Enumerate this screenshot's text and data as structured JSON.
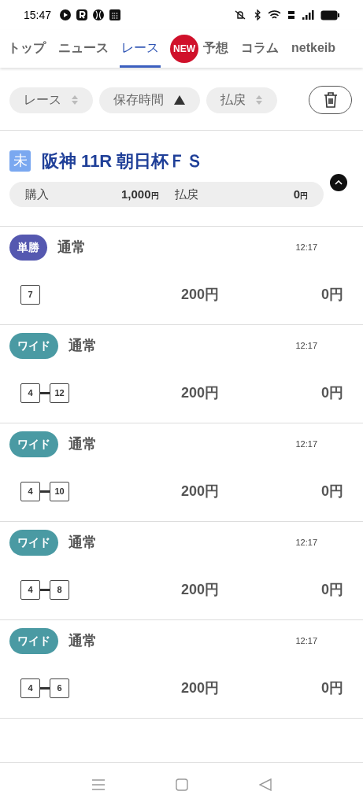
{
  "status_bar": {
    "time": "15:47"
  },
  "tabs": [
    {
      "label": "トップ",
      "selected": false
    },
    {
      "label": "ニュース",
      "selected": false
    },
    {
      "label": "レース",
      "selected": true
    },
    {
      "label": "予想",
      "selected": false,
      "badge": "NEW"
    },
    {
      "label": "コラム",
      "selected": false
    },
    {
      "label": "netkeib",
      "selected": false
    }
  ],
  "sort_chips": [
    {
      "label": "レース",
      "kind": "sortable"
    },
    {
      "label": "保存時間",
      "kind": "ascending"
    },
    {
      "label": "払戻",
      "kind": "sortable"
    }
  ],
  "race": {
    "status": "未",
    "title": "阪神 11R 朝日杯ＦＳ",
    "expanded": true,
    "summary": [
      {
        "label": "購入",
        "amount": "1,000",
        "unit": "円"
      },
      {
        "label": "払戻",
        "amount": "0",
        "unit": "円"
      }
    ]
  },
  "bets": [
    {
      "type": "単勝",
      "color": "#5558b0",
      "method": "通常",
      "time": "12:17",
      "horses": [
        "7"
      ],
      "stake": "200円",
      "payout": "0円"
    },
    {
      "type": "ワイド",
      "color": "#4a9aa3",
      "method": "通常",
      "time": "12:17",
      "horses": [
        "4",
        "12"
      ],
      "stake": "200円",
      "payout": "0円"
    },
    {
      "type": "ワイド",
      "color": "#4a9aa3",
      "method": "通常",
      "time": "12:17",
      "horses": [
        "4",
        "10"
      ],
      "stake": "200円",
      "payout": "0円"
    },
    {
      "type": "ワイド",
      "color": "#4a9aa3",
      "method": "通常",
      "time": "12:17",
      "horses": [
        "4",
        "8"
      ],
      "stake": "200円",
      "payout": "0円"
    },
    {
      "type": "ワイド",
      "color": "#4a9aa3",
      "method": "通常",
      "time": "12:17",
      "horses": [
        "4",
        "6"
      ],
      "stake": "200円",
      "payout": "0円"
    }
  ]
}
